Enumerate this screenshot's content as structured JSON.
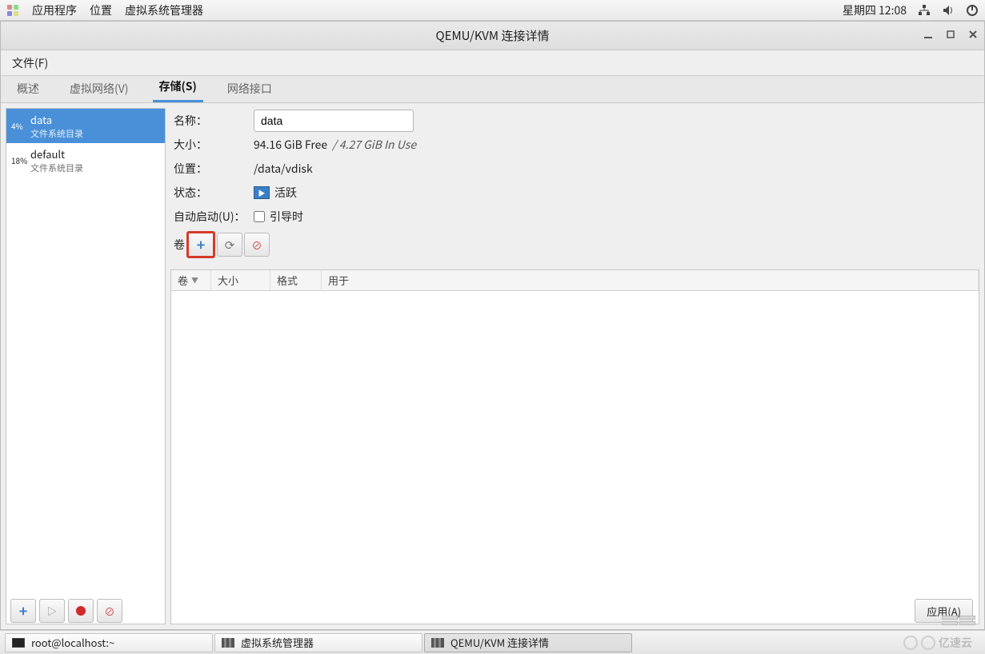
{
  "system": {
    "apps": "应用程序",
    "places": "位置",
    "vmm": "虚拟系统管理器",
    "clock": "星期四 12:08"
  },
  "window": {
    "title": "QEMU/KVM 连接详情",
    "menu_file": "文件(F)"
  },
  "tabs": {
    "overview": "概述",
    "vnet": "虚拟网络(V)",
    "storage": "存储(S)",
    "netif": "网络接口"
  },
  "pools": [
    {
      "pct": "4%",
      "name": "data",
      "sub": "文件系统目录",
      "selected": true
    },
    {
      "pct": "18%",
      "name": "default",
      "sub": "文件系统目录",
      "selected": false
    }
  ],
  "form": {
    "name_label": "名称：",
    "name_value": "data",
    "size_label": "大小：",
    "size_free": "94.16 GiB Free",
    "size_used": "/ 4.27 GiB In Use",
    "loc_label": "位置：",
    "loc_value": "/data/vdisk",
    "state_label": "状态：",
    "state_value": "活跃",
    "auto_label": "自动启动(U)：",
    "auto_chk": "引导时",
    "vol_label": "卷"
  },
  "vol_cols": {
    "c1": "卷",
    "c2": "大小",
    "c3": "格式",
    "c4": "用于"
  },
  "apply": "应用(A)",
  "taskbar": {
    "t1": "root@localhost:~",
    "t2": "虚拟系统管理器",
    "t3": "QEMU/KVM 连接详情"
  },
  "watermark": "亿速云"
}
